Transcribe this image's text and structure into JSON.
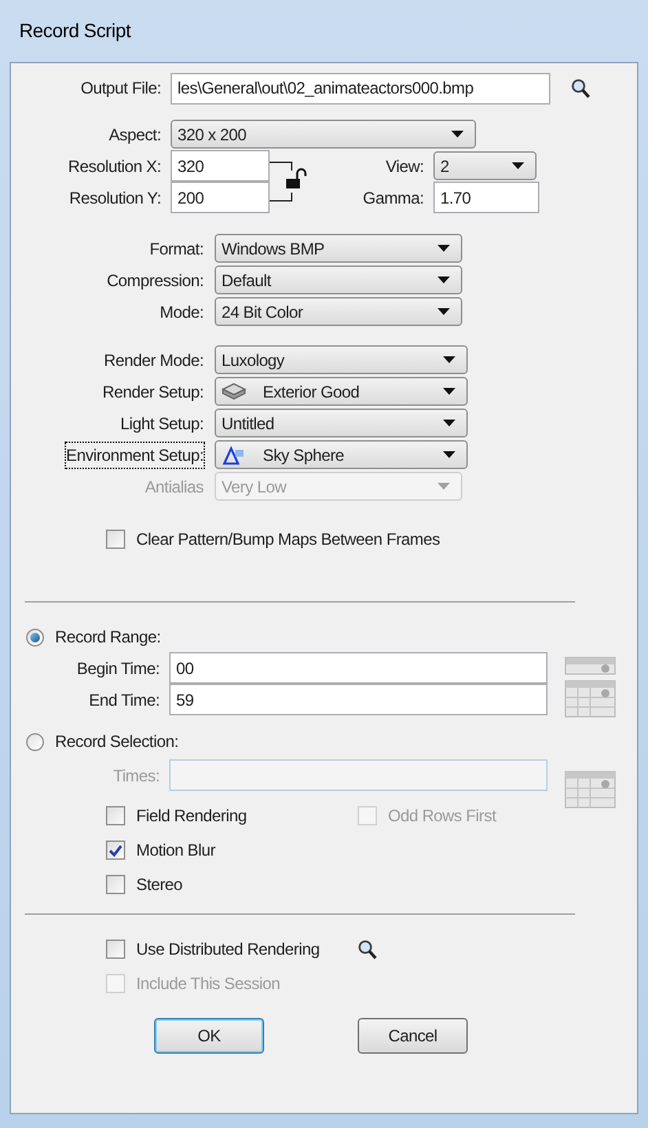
{
  "window": {
    "title": "Record Script"
  },
  "output_file": {
    "label": "Output File:",
    "value": "les\\General\\out\\02_animateactors000.bmp"
  },
  "aspect": {
    "label": "Aspect:",
    "value": "320 x 200"
  },
  "resolution_x": {
    "label": "Resolution X:",
    "value": "320"
  },
  "resolution_y": {
    "label": "Resolution Y:",
    "value": "200"
  },
  "lock": {
    "locked": false
  },
  "view": {
    "label": "View:",
    "value": "2"
  },
  "gamma": {
    "label": "Gamma:",
    "value": "1.70"
  },
  "output_settings": [
    {
      "label": "Format:",
      "value": "Windows BMP",
      "kind": "plain",
      "disabled": false
    },
    {
      "label": "Compression:",
      "value": "Default",
      "kind": "plain",
      "disabled": false
    },
    {
      "label": "Mode:",
      "value": "24 Bit Color",
      "kind": "plain",
      "disabled": false
    }
  ],
  "render_settings": [
    {
      "label": "Render Mode:",
      "value": "Luxology",
      "kind": "plain",
      "disabled": false,
      "focused": false
    },
    {
      "label": "Render Setup:",
      "value": "Exterior Good",
      "kind": "material",
      "disabled": false,
      "focused": false
    },
    {
      "label": "Light Setup:",
      "value": "Untitled",
      "kind": "plain",
      "disabled": false,
      "focused": false
    },
    {
      "label": "Environment Setup:",
      "value": "Sky Sphere",
      "kind": "environment",
      "disabled": false,
      "focused": true
    },
    {
      "label": "Antialias",
      "value": "Very Low",
      "kind": "plain",
      "disabled": true,
      "focused": false
    }
  ],
  "clear_maps": {
    "label": "Clear Pattern/Bump Maps Between Frames",
    "checked": false,
    "disabled": false
  },
  "record_range": {
    "label": "Record Range:",
    "selected": true
  },
  "begin_time": {
    "label": "Begin Time:",
    "value": "00"
  },
  "end_time": {
    "label": "End Time:",
    "value": "59"
  },
  "record_selection": {
    "label": "Record Selection:",
    "selected": false
  },
  "times": {
    "label": "Times:",
    "disabled": true
  },
  "options": [
    [
      {
        "label": "Field Rendering",
        "checked": false,
        "disabled": false
      },
      {
        "label": "Odd Rows First",
        "checked": false,
        "disabled": true
      }
    ],
    [
      {
        "label": "Motion Blur",
        "checked": true,
        "disabled": false
      }
    ],
    [
      {
        "label": "Stereo",
        "checked": false,
        "disabled": false
      }
    ]
  ],
  "distributed": {
    "label": "Use Distributed Rendering",
    "checked": false,
    "disabled": false
  },
  "include_session": {
    "label": "Include This Session",
    "checked": false,
    "disabled": true
  },
  "buttons": [
    {
      "label": "OK",
      "default": true
    },
    {
      "label": "Cancel",
      "default": false
    }
  ]
}
